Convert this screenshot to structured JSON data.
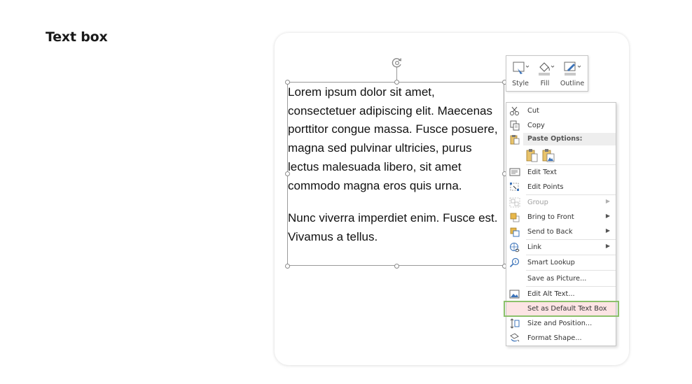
{
  "section_title": "Text box",
  "textbox": {
    "paragraphs": [
      "Lorem ipsum dolor sit amet, consectetuer adipiscing elit. Maecenas porttitor congue massa. Fusce posuere, magna sed pulvinar ultricies, purus lectus malesuada libero, sit amet commodo magna eros quis urna.",
      "Nunc viverra imperdiet enim. Fusce est. Vivamus a tellus."
    ]
  },
  "mini_toolbar": {
    "style_label": "Style",
    "fill_label": "Fill",
    "outline_label": "Outline",
    "icons": [
      "style-icon",
      "fill-bucket-icon",
      "outline-pen-icon"
    ]
  },
  "context_menu": {
    "cut": "Cut",
    "copy": "Copy",
    "paste_options_header": "Paste Options:",
    "edit_text": "Edit Text",
    "edit_points": "Edit Points",
    "group": "Group",
    "bring_to_front": "Bring to Front",
    "send_to_back": "Send to Back",
    "link": "Link",
    "smart_lookup": "Smart Lookup",
    "save_as_picture": "Save as Picture...",
    "edit_alt_text": "Edit Alt Text...",
    "set_as_default_text_box": "Set as Default Text Box",
    "size_and_position": "Size and Position...",
    "format_shape": "Format Shape..."
  },
  "colors": {
    "highlight_border": "#8cc06b",
    "highlight_fill": "#fce4e4",
    "menu_border": "#c6c6c6",
    "text": "#111111"
  }
}
